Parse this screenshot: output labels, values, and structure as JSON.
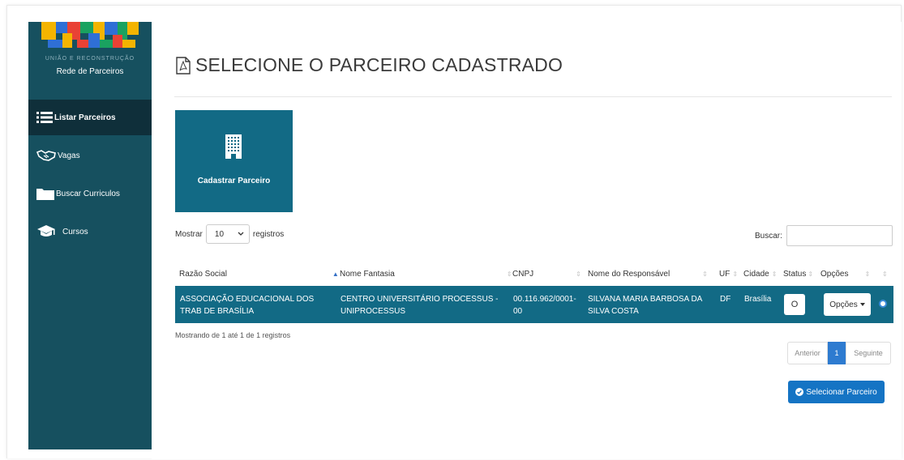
{
  "sidebar": {
    "logo": {
      "text": "BRASIL",
      "tagline": "UNIÃO E RECONSTRUÇÃO",
      "subtitle": "Rede de Parceiros"
    },
    "items": [
      {
        "label": "Listar Parceiros",
        "icon": "list-icon",
        "active": true
      },
      {
        "label": "Vagas",
        "icon": "handshake-icon",
        "active": false
      },
      {
        "label": "Buscar Curriculos",
        "icon": "folder-icon",
        "active": false
      },
      {
        "label": "Cursos",
        "icon": "graduation-cap-icon",
        "active": false
      }
    ]
  },
  "main": {
    "title": "SELECIONE O PARCEIRO CADASTRADO",
    "title_icon": "pdf-file-icon",
    "tile": {
      "label": "Cadastrar Parceiro",
      "icon": "building-icon"
    },
    "length": {
      "prefix": "Mostrar",
      "value": "10",
      "suffix": "registros"
    },
    "search": {
      "label": "Buscar:",
      "value": "",
      "placeholder": ""
    },
    "table": {
      "columns": [
        "Razão Social",
        "Nome Fantasia",
        "CNPJ",
        "Nome do Responsável",
        "UF",
        "Cidade",
        "Status",
        "Opções"
      ],
      "rows": [
        {
          "razao_social": "ASSOCIAÇÃO EDUCACIONAL DOS TRAB DE BRASÍLIA",
          "nome_fantasia": "CENTRO UNIVERSITÁRIO PROCESSUS - UNIPROCESSUS",
          "cnpj": "00.116.962/0001-00",
          "responsavel": "SILVANA MARIA BARBOSA DA SILVA COSTA",
          "uf": "DF",
          "cidade": "Brasília",
          "status": "O",
          "opcoes": "Opções"
        }
      ]
    },
    "info": "Mostrando de 1 até 1 de 1 registros",
    "pagination": {
      "prev": "Anterior",
      "current": "1",
      "next": "Seguinte"
    },
    "select_button": "Selecionar Parceiro"
  },
  "colors": {
    "sidebar": "#16505f",
    "sidebar_active": "#0f2f3a",
    "tile": "#126a85",
    "row": "#126a85",
    "primary": "#1574c4"
  }
}
